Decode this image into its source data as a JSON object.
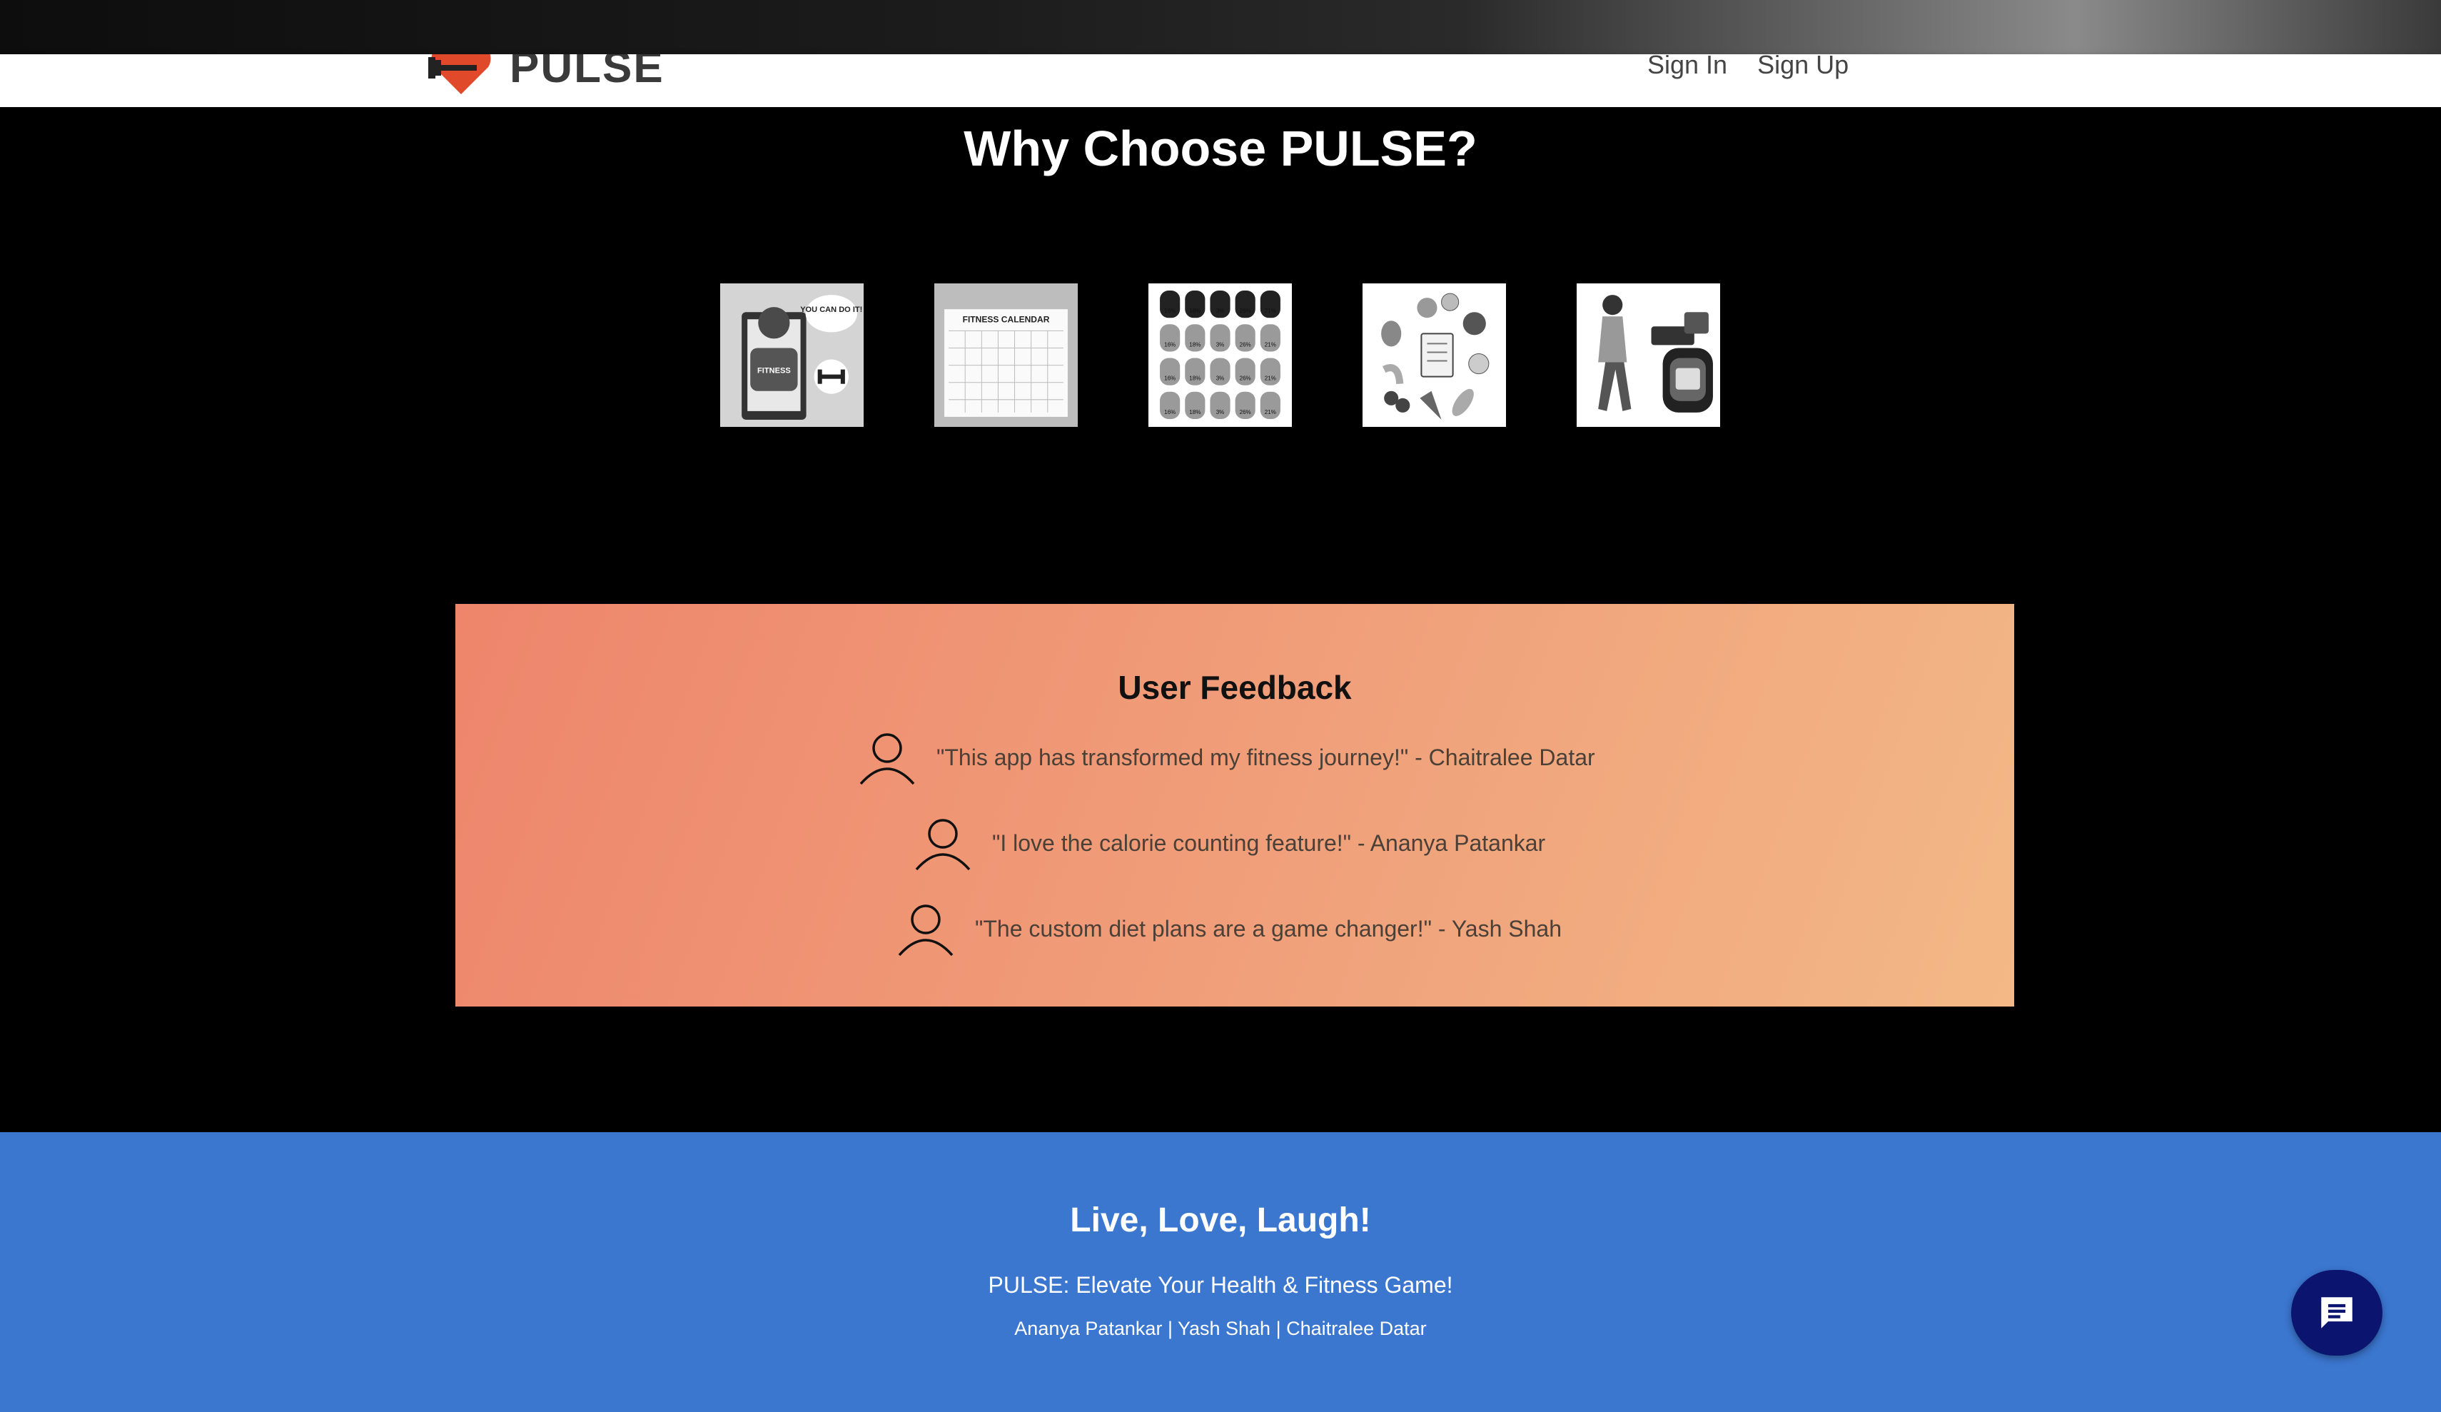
{
  "header": {
    "logo_text": "PULSE",
    "nav": {
      "sign_in": "Sign In",
      "sign_up": "Sign Up"
    }
  },
  "why": {
    "title": "Why Choose PULSE?",
    "features": [
      {
        "icon": "motivation-illustration",
        "text": "YOU CAN DO IT!",
        "shirt": "FITNESS"
      },
      {
        "icon": "fitness-calendar-illustration",
        "text": "FITNESS CALENDAR"
      },
      {
        "icon": "nutrition-percentages-illustration",
        "values": [
          "16%",
          "18%",
          "3%",
          "26%",
          "21%"
        ]
      },
      {
        "icon": "healthy-food-illustration"
      },
      {
        "icon": "smartwatch-tracking-illustration"
      }
    ]
  },
  "feedback": {
    "title": "User Feedback",
    "items": [
      {
        "quote": "\"This app has transformed my fitness journey!\" - Chaitralee Datar"
      },
      {
        "quote": "\"I love the calorie counting feature!\" - Ananya Patankar"
      },
      {
        "quote": "\"The custom diet plans are a game changer!\" - Yash Shah"
      }
    ]
  },
  "footer": {
    "heading": "Live, Love, Laugh!",
    "tagline": "PULSE: Elevate Your Health & Fitness Game!",
    "credits": "Ananya Patankar | Yash Shah | Chaitralee Datar"
  },
  "chat": {
    "icon": "chat-icon"
  },
  "colors": {
    "footer_bg": "#3b76cf",
    "feedback_gradient_start": "#ee856c",
    "feedback_gradient_end": "#f3b886",
    "chat_button": "#0b1570"
  }
}
